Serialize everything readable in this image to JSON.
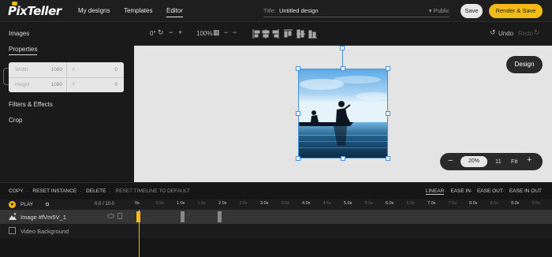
{
  "app": {
    "logo": "PixTeller",
    "nav": [
      "My designs",
      "Templates",
      "Editor"
    ],
    "title_label": "Title:",
    "title_value": "Untitled design",
    "visibility": "▾ Public",
    "save_label": "Save",
    "render_label": "Render & Save"
  },
  "sidebar": {
    "items": [
      "Images",
      "Properties",
      "Filters & Effects",
      "Crop"
    ],
    "props": {
      "width_label": "Width",
      "width_value": "1080",
      "height_label": "Height",
      "height_value": "1080",
      "x_label": "X",
      "x_value": "0",
      "y_label": "Y",
      "y_value": "0"
    }
  },
  "toolbar": {
    "rotation": "0°",
    "opacity": "100%",
    "undo_label": "Undo",
    "redo_label": "Redo"
  },
  "canvas": {
    "design_label": "Design",
    "zoom_value": "20%",
    "zoom_step": "11",
    "fit_label": "Fit"
  },
  "timeline": {
    "actions": [
      "COPY",
      "RESET INSTANCE",
      "DELETE",
      "RESET TIMELINE TO DEFAULT"
    ],
    "easing": [
      "LINEAR",
      "EASE IN",
      "EASE OUT",
      "EASE IN OUT"
    ],
    "play_label": "PLAY",
    "time_readout": "0.0 / 10.0",
    "ruler": [
      "0s",
      "0.5s",
      "1.0s",
      "1.5s",
      "2.0s",
      "2.5s",
      "3.0s",
      "3.5s",
      "4.0s",
      "4.5s",
      "5.0s",
      "5.5s",
      "6.0s",
      "6.5s",
      "7.0s",
      "7.5s",
      "8.0s",
      "8.5s",
      "9.0s",
      "9.5s"
    ],
    "layers": [
      "Image #fVm5V_1",
      "Video Background"
    ]
  },
  "colors": {
    "accent": "#f4bb15",
    "selection": "#4a90d9",
    "background": "#1a1a1a"
  }
}
